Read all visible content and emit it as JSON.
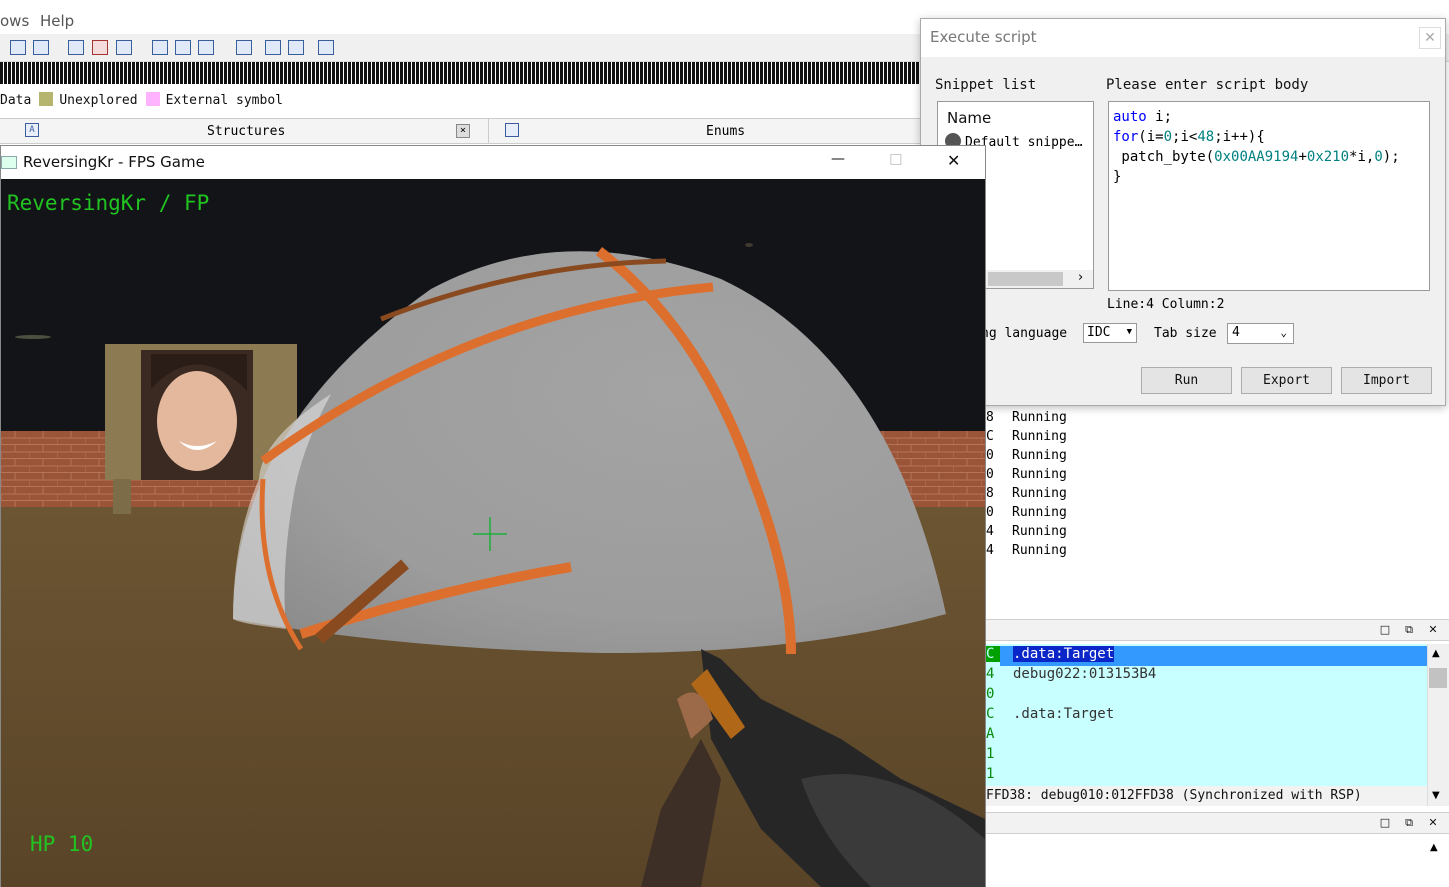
{
  "ida": {
    "menu": {
      "windows_fragment": "ows",
      "help": "Help"
    },
    "legend": [
      {
        "label": "Data",
        "color": "#c6b46e"
      },
      {
        "label": "Unexplored",
        "color": "#b5b570"
      },
      {
        "label": "External symbol",
        "color": "#ffb3ff"
      }
    ],
    "tabs": {
      "structures": "Structures",
      "enums": "Enums"
    },
    "threads": [
      {
        "tid": "8",
        "state": "Running"
      },
      {
        "tid": "C",
        "state": "Running"
      },
      {
        "tid": "0",
        "state": "Running"
      },
      {
        "tid": "0",
        "state": "Running"
      },
      {
        "tid": "8",
        "state": "Running"
      },
      {
        "tid": "0",
        "state": "Running"
      },
      {
        "tid": "4",
        "state": "Running"
      },
      {
        "tid": "4",
        "state": "Running"
      }
    ],
    "stack": [
      {
        "addr": "C",
        "value": ".data:Target",
        "highlight": true
      },
      {
        "addr": "4",
        "value": "debug022:013153B4"
      },
      {
        "addr": "0",
        "value": ""
      },
      {
        "addr": "C",
        "value": ".data:Target"
      },
      {
        "addr": "A",
        "value": ""
      },
      {
        "addr": "1",
        "value": ""
      },
      {
        "addr": "1",
        "value": ""
      }
    ],
    "stack_status": "FFD38: debug010:012FFD38 (Synchronized with RSP)",
    "panel_buttons": {
      "restore": "□",
      "float": "⧉",
      "close": "✕"
    }
  },
  "dialog": {
    "title": "Execute script",
    "close": "✕",
    "snippet_list_label": "Snippet list",
    "snippet_name_header": "Name",
    "snippet_item": "Default snippe…",
    "script_body_label": "Please enter script body",
    "code": {
      "line1_kw": "auto",
      "line1_rest": " i;",
      "line2_kw": "for",
      "line2_a": "(i=",
      "line2_n1": "0",
      "line2_b": ";i<",
      "line2_n2": "48",
      "line2_c": ";i++){",
      "line3_a": " patch_byte(",
      "line3_n1": "0x00AA9194",
      "line3_b": "+",
      "line3_n2": "0x210",
      "line3_c": "*i,",
      "line3_n3": "0",
      "line3_d": ");",
      "line4": "}"
    },
    "position": "Line:4  Column:2",
    "language_label": "ng language",
    "language_value": "IDC",
    "tab_size_label": "Tab size",
    "tab_size_value": "4",
    "buttons": {
      "run": "Run",
      "export": "Export",
      "import": "Import"
    }
  },
  "game": {
    "window_title": "ReversingKr - FPS Game",
    "controls": {
      "minimize": "—",
      "maximize": "☐",
      "close": "✕"
    },
    "hud_title": "ReversingKr / FP",
    "hp": "HP 10"
  }
}
